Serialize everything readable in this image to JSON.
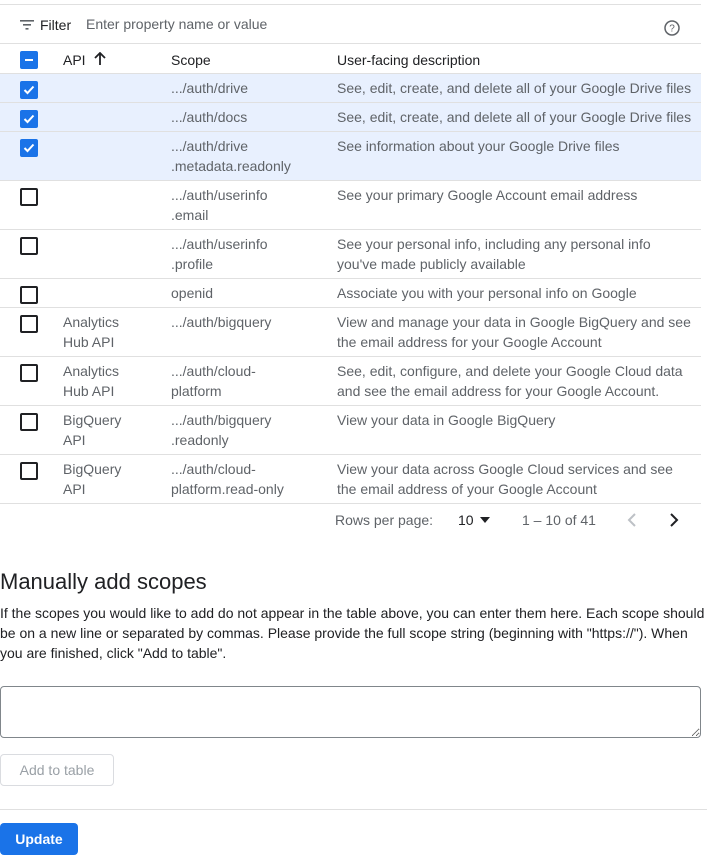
{
  "filter": {
    "label": "Filter",
    "placeholder": "Enter property name or value",
    "filter_icon": "filter-list-icon",
    "help_icon": "help-circle-icon"
  },
  "table": {
    "columns": {
      "api": "API",
      "scope": "Scope",
      "description": "User-facing description"
    },
    "sort_icon": "arrow-up-icon",
    "rows": [
      {
        "checked": true,
        "api": "",
        "scope": ".../auth/drive",
        "description": "See, edit, create, and delete all of your Google Drive files"
      },
      {
        "checked": true,
        "api": "",
        "scope": ".../auth/docs",
        "description": "See, edit, create, and delete all of your Google Drive files"
      },
      {
        "checked": true,
        "api": "",
        "scope": ".../auth/drive\n.metadata.readonly",
        "description": "See information about your Google Drive files"
      },
      {
        "checked": false,
        "api": "",
        "scope": ".../auth/userinfo\n.email",
        "description": "See your primary Google Account email address"
      },
      {
        "checked": false,
        "api": "",
        "scope": ".../auth/userinfo\n.profile",
        "description": "See your personal info, including any personal info\nyou've made publicly available"
      },
      {
        "checked": false,
        "api": "",
        "scope": "openid",
        "description": "Associate you with your personal info on Google"
      },
      {
        "checked": false,
        "api": "Analytics\nHub API",
        "scope": ".../auth/bigquery",
        "description": "View and manage your data in Google BigQuery and see\nthe email address for your Google Account"
      },
      {
        "checked": false,
        "api": "Analytics\nHub API",
        "scope": ".../auth/cloud-\nplatform",
        "description": "See, edit, configure, and delete your Google Cloud data\nand see the email address for your Google Account."
      },
      {
        "checked": false,
        "api": "BigQuery\nAPI",
        "scope": ".../auth/bigquery\n.readonly",
        "description": "View your data in Google BigQuery"
      },
      {
        "checked": false,
        "api": "BigQuery\nAPI",
        "scope": ".../auth/cloud-\nplatform.read-only",
        "description": "View your data across Google Cloud services and see\nthe email address of your Google Account"
      }
    ]
  },
  "pagination": {
    "rows_per_page_label": "Rows per page:",
    "rows_per_page_value": "10",
    "range": "1 – 10 of 41",
    "prev_icon": "chevron-left-icon",
    "next_icon": "chevron-right-icon"
  },
  "manual": {
    "title": "Manually add scopes",
    "description": "If the scopes you would like to add do not appear in the table above, you can enter them here. Each scope should be on a new line or separated by commas. Please provide the full scope string (beginning with \"https://\"). When you are finished, click \"Add to table\".",
    "textarea_value": "",
    "add_button": "Add to table"
  },
  "footer": {
    "update_button": "Update"
  },
  "colors": {
    "accent": "#1a73e8",
    "selected_row": "#e8f0fe"
  }
}
